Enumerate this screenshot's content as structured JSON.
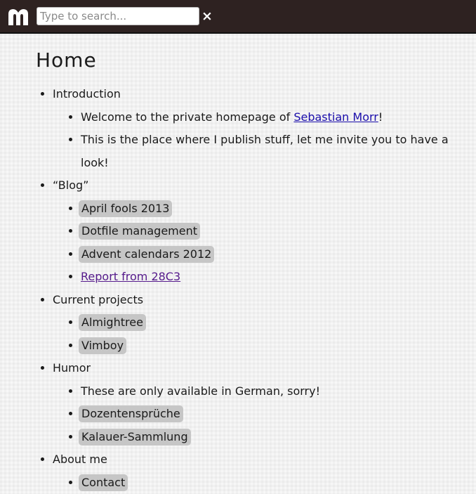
{
  "header": {
    "logo_icon": "morr-m-logo-icon",
    "search_placeholder": "Type to search...",
    "clear_label": "×",
    "background": "#2e2221"
  },
  "page": {
    "title": "Home"
  },
  "sections": [
    {
      "label": "Introduction",
      "items": [
        {
          "type": "text_with_link",
          "before": "Welcome to the private homepage of ",
          "link": "Sebastian Morr",
          "after": "!"
        },
        {
          "type": "text",
          "text": "This is the place where I publish stuff, let me invite you to have a look!"
        }
      ]
    },
    {
      "label": "“Blog”",
      "items": [
        {
          "type": "tag",
          "text": "April fools 2013"
        },
        {
          "type": "tag",
          "text": "Dotfile management"
        },
        {
          "type": "tag",
          "text": "Advent calendars 2012"
        },
        {
          "type": "link",
          "text": "Report from 28C3"
        }
      ]
    },
    {
      "label": "Current projects",
      "items": [
        {
          "type": "tag",
          "text": "Almightree"
        },
        {
          "type": "tag",
          "text": "Vimboy"
        }
      ]
    },
    {
      "label": "Humor",
      "items": [
        {
          "type": "text",
          "text": "These are only available in German, sorry!"
        },
        {
          "type": "tag",
          "text": "Dozentensprüche"
        },
        {
          "type": "tag",
          "text": "Kalauer-Sammlung"
        }
      ]
    },
    {
      "label": "About me",
      "items": [
        {
          "type": "tag",
          "text": "Contact"
        }
      ]
    }
  ],
  "colors": {
    "link": "#1a0dab",
    "visited_link": "#551a8b",
    "tag_background": "#c6c6c6"
  }
}
